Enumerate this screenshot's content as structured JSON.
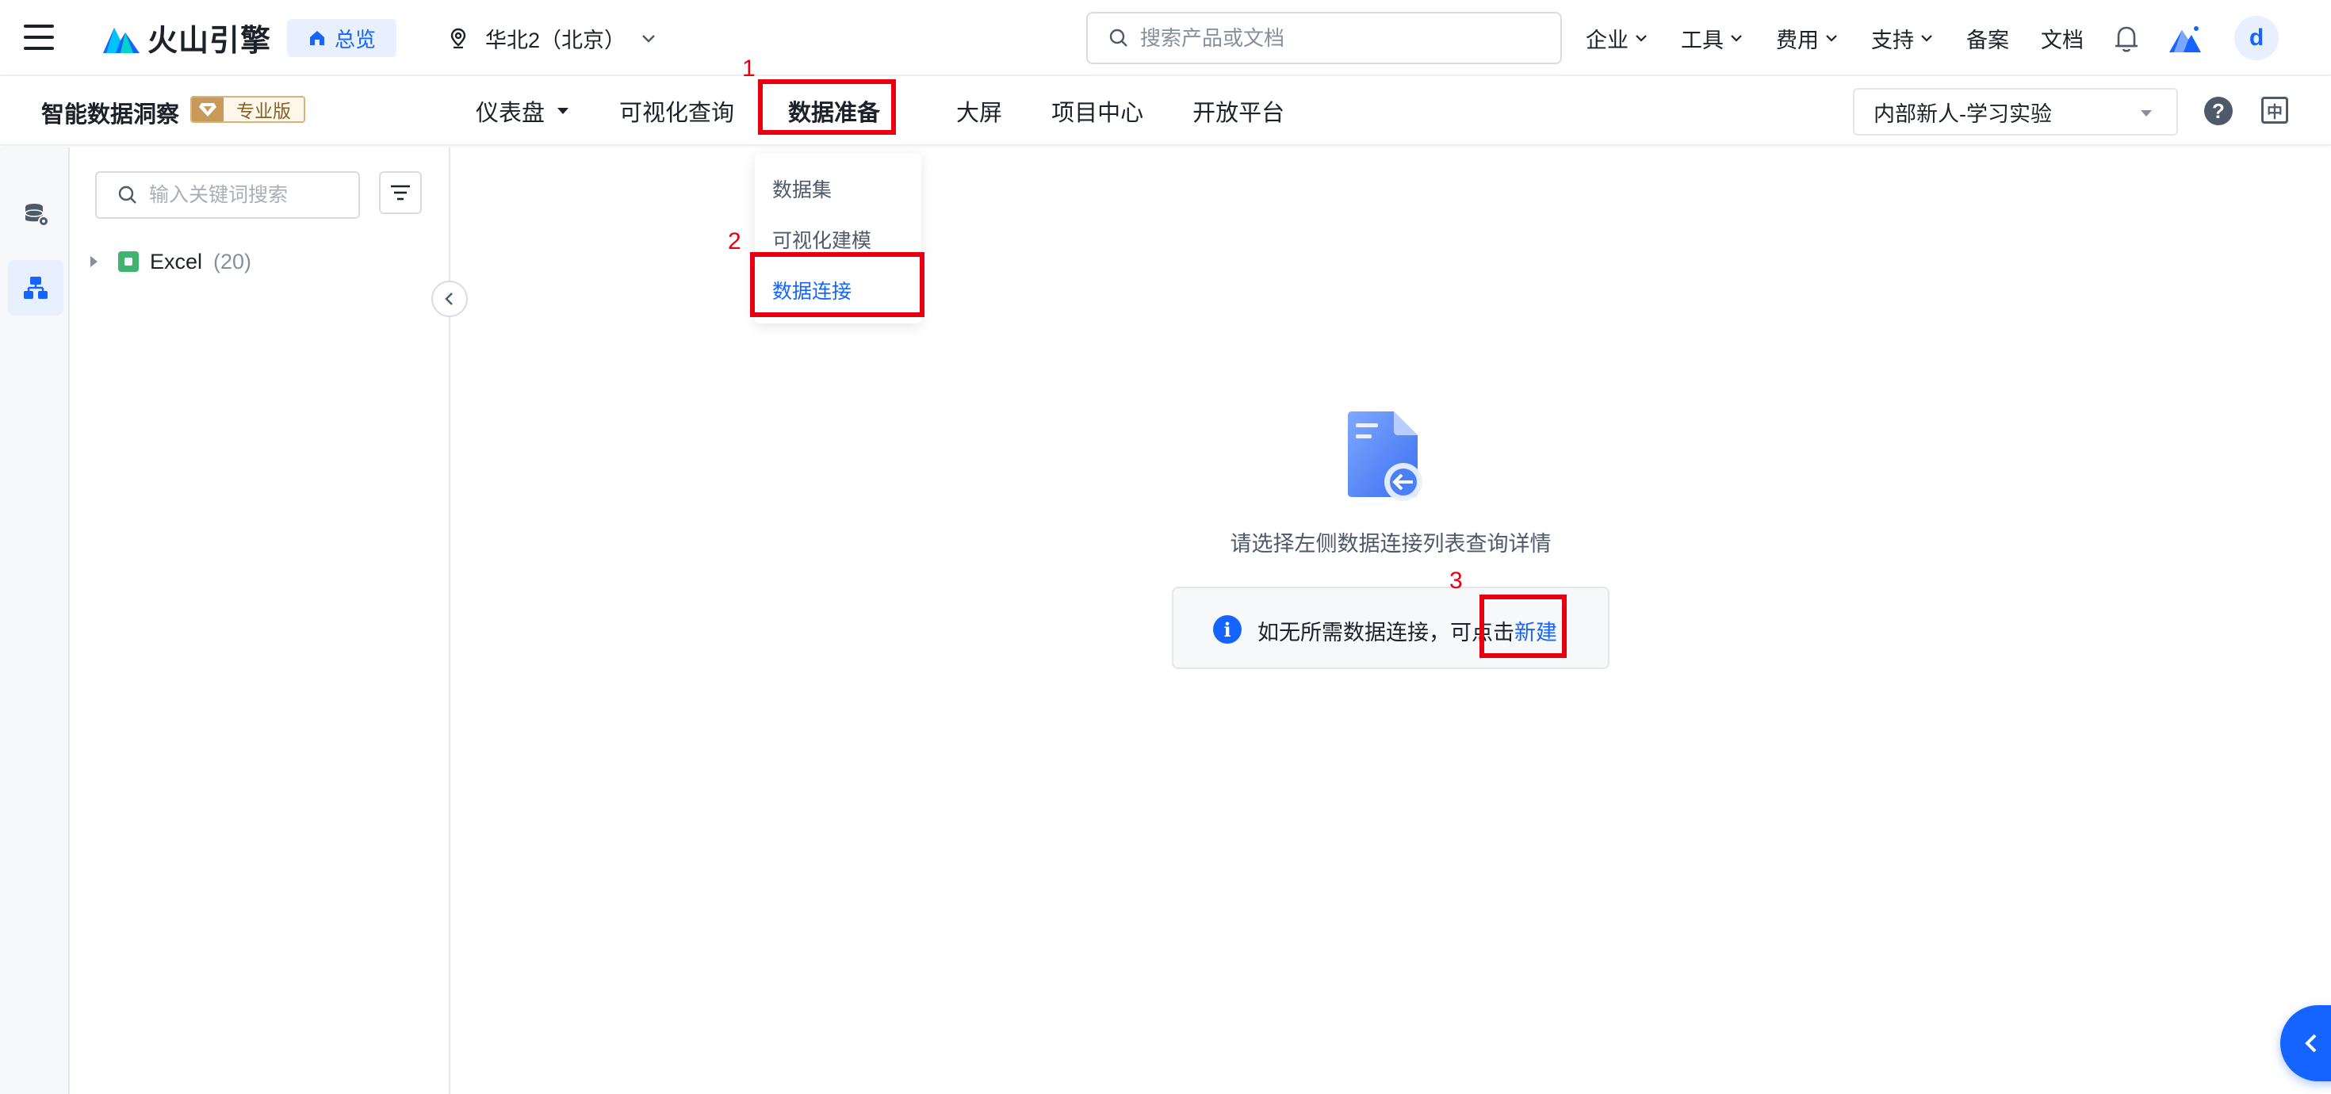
{
  "topbar": {
    "logo_text": "火山引擎",
    "home_label": "总览",
    "region_label": "华北2（北京）",
    "search_placeholder": "搜索产品或文档",
    "nav": [
      {
        "label": "企业",
        "has_menu": true
      },
      {
        "label": "工具",
        "has_menu": true
      },
      {
        "label": "费用",
        "has_menu": true
      },
      {
        "label": "支持",
        "has_menu": true
      },
      {
        "label": "备案",
        "has_menu": false
      },
      {
        "label": "文档",
        "has_menu": false
      }
    ],
    "avatar_letter": "d"
  },
  "product_bar": {
    "product_name": "智能数据洞察",
    "edition_label": "专业版",
    "nav": [
      {
        "label": "仪表盘",
        "has_menu": true,
        "active": false
      },
      {
        "label": "可视化查询",
        "has_menu": false,
        "active": false
      },
      {
        "label": "数据准备",
        "has_menu": false,
        "active": true
      },
      {
        "label": "大屏",
        "has_menu": false,
        "active": false
      },
      {
        "label": "项目中心",
        "has_menu": false,
        "active": false
      },
      {
        "label": "开放平台",
        "has_menu": false,
        "active": false
      }
    ],
    "project_selected": "内部新人-学习实验",
    "help_glyph": "?",
    "lang_glyph": "中"
  },
  "dropdown": {
    "items": [
      {
        "label": "数据集",
        "active": false
      },
      {
        "label": "可视化建模",
        "active": false
      },
      {
        "label": "数据连接",
        "active": true
      }
    ]
  },
  "tree": {
    "search_placeholder": "输入关键词搜索",
    "items": [
      {
        "label": "Excel",
        "count": "(20)"
      }
    ]
  },
  "empty_state": {
    "message": "请选择左侧数据连接列表查询详情",
    "hint_prefix": "如无所需数据连接，可点击",
    "hint_link": "新建"
  },
  "annotations": {
    "marks": [
      "1",
      "2",
      "3"
    ],
    "color": "#e60012"
  },
  "colors": {
    "accent": "#1664ff",
    "text": "#1d2129",
    "muted": "#86909c"
  }
}
